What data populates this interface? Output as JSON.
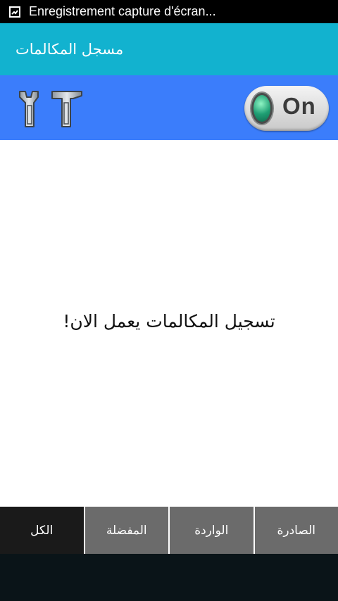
{
  "status_bar": {
    "notification_icon": "screen-recording-icon",
    "text": "Enregistrement capture d'écran..."
  },
  "app": {
    "title": "مسجل المكالمات"
  },
  "toolbar": {
    "tools_icon": "tools-icon",
    "switch_label": "On",
    "switch_state": true,
    "switch_led_color": "#1f9f74"
  },
  "content": {
    "message": "تسجيل المكالمات يعمل الان!"
  },
  "tabs": [
    {
      "label": "الكل",
      "active": true
    },
    {
      "label": "المفضلة",
      "active": false
    },
    {
      "label": "الواردة",
      "active": false
    },
    {
      "label": "الصادرة",
      "active": false
    }
  ],
  "colors": {
    "action_bar": "#12b2cf",
    "toolbar": "#3b7dfb",
    "tab_active": "#1a1a1a",
    "tab_inactive": "#6b6b6b"
  }
}
